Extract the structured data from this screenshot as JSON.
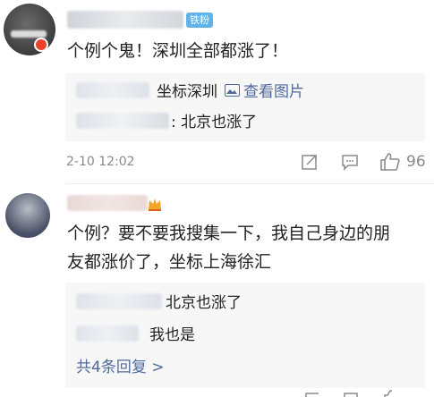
{
  "comments": [
    {
      "badge": "铁粉",
      "text": "个例个鬼！深圳全部都涨了！",
      "replies": [
        {
          "text": "坐标深圳",
          "link_text": "查看图片",
          "link_icon": "image-icon"
        },
        {
          "text": ": 北京也涨了"
        }
      ],
      "timestamp": "2-10 12:02",
      "like_count": "96"
    },
    {
      "text_line1": "个例？要不要我搜集一下，我自己身边的朋",
      "text_line2": "友都涨价了，坐标上海徐汇",
      "replies": [
        {
          "text": "北京也涨了"
        },
        {
          "text": "我也是"
        }
      ],
      "more_replies": "共4条回复 >"
    }
  ],
  "colors": {
    "link": "#506a9c",
    "badge": "#5fb3e6",
    "meta": "#8a8a8a",
    "reply_bg": "#f7f7f7"
  }
}
